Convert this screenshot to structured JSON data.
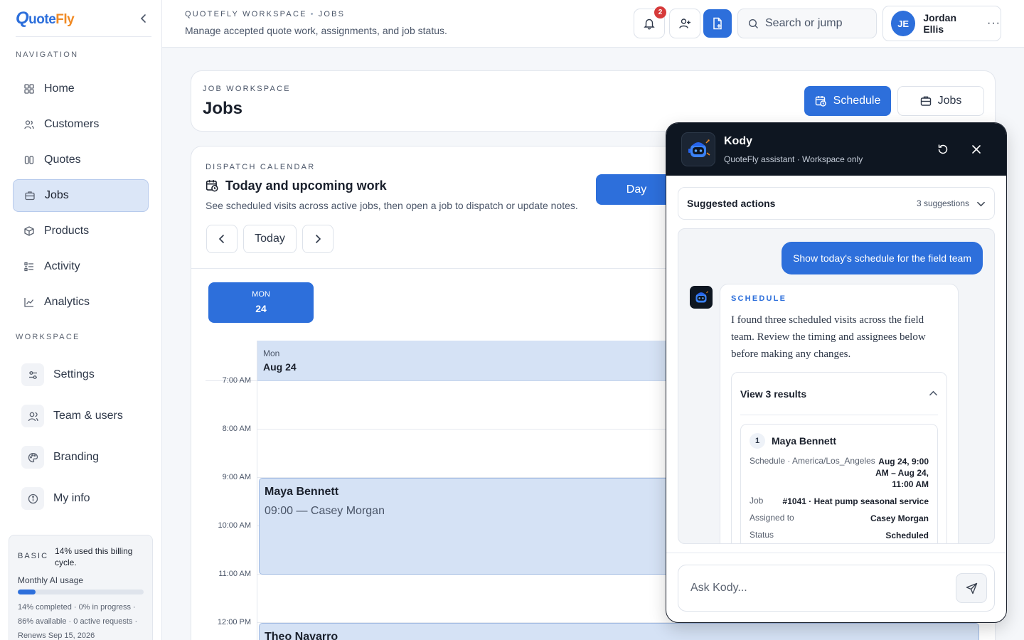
{
  "brand": {
    "q": "Q",
    "uote": "uote",
    "fly": "Fly"
  },
  "sidebar": {
    "nav_heading": "NAVIGATION",
    "nav_items": [
      {
        "label": "Home",
        "icon": "grid-icon"
      },
      {
        "label": "Customers",
        "icon": "users-icon"
      },
      {
        "label": "Quotes",
        "icon": "quote-icon"
      },
      {
        "label": "Jobs",
        "icon": "briefcase-icon",
        "active": true
      },
      {
        "label": "Products",
        "icon": "box-icon"
      },
      {
        "label": "Activity",
        "icon": "list-icon"
      },
      {
        "label": "Analytics",
        "icon": "chart-icon"
      }
    ],
    "workspace_heading": "WORKSPACE",
    "workspace_items": [
      {
        "label": "Settings",
        "icon": "sliders-icon"
      },
      {
        "label": "Team & users",
        "icon": "user-icon"
      },
      {
        "label": "Branding",
        "icon": "palette-icon"
      },
      {
        "label": "My info",
        "icon": "info-icon"
      }
    ],
    "billing": {
      "plan": "BASIC",
      "note": "14% used this billing cycle.",
      "usage_label": "Monthly AI usage",
      "usage_percent": 14,
      "meta_1": "14% completed · 0% in progress ·",
      "meta_2": "86% available · 0 active requests ·",
      "meta_3": "Renews Sep 15, 2026"
    }
  },
  "topbar": {
    "crumb_1": "QUOTEFLY WORKSPACE",
    "crumb_sep": "•",
    "crumb_2": "JOBS",
    "description": "Manage accepted quote work, assignments, and job status.",
    "notifications_count": "2",
    "search_placeholder": "Search or jump",
    "user_initials": "JE",
    "user_name": "Jordan Ellis",
    "more": "···"
  },
  "header": {
    "eyebrow": "JOB WORKSPACE",
    "title": "Jobs",
    "schedule_label": "Schedule",
    "jobs_label": "Jobs"
  },
  "calendar": {
    "eyebrow": "DISPATCH CALENDAR",
    "title": "Today and upcoming work",
    "description": "See scheduled visits across active jobs, then open a job to dispatch or update notes.",
    "view_label": "Day",
    "today_label": "Today",
    "chip_dow": "MON",
    "chip_day": "24",
    "col_dow": "Mon",
    "col_date": "Aug 24",
    "times": [
      "7:00 AM",
      "8:00 AM",
      "9:00 AM",
      "10:00 AM",
      "11:00 AM",
      "12:00 PM"
    ],
    "events": [
      {
        "name": "Maya Bennett",
        "meta": "09:00 — Casey Morgan"
      },
      {
        "name": "Theo Navarro",
        "meta": ""
      }
    ]
  },
  "kody": {
    "name": "Kody",
    "subtitle": "QuoteFly assistant · Workspace only",
    "suggested_title": "Suggested actions",
    "suggested_count": "3 suggestions",
    "user_message": "Show today's schedule for the field team",
    "bot_tag": "SCHEDULE",
    "bot_text": "I found three scheduled visits across the field team. Review the timing and assignees below before making any changes.",
    "results_title": "View 3 results",
    "result": {
      "index": "1",
      "name": "Maya Bennett",
      "schedule_key": "Schedule · America/Los_Angeles",
      "schedule_val_1": "Aug 24, 9:00",
      "schedule_val_2": "AM – Aug 24,",
      "schedule_val_3": "11:00 AM",
      "job_key": "Job",
      "job_val": "#1041 · Heat pump seasonal service",
      "assigned_key": "Assigned to",
      "assigned_val": "Casey Morgan",
      "status_key": "Status",
      "status_val": "Scheduled"
    },
    "ask_placeholder": "Ask Kody..."
  }
}
